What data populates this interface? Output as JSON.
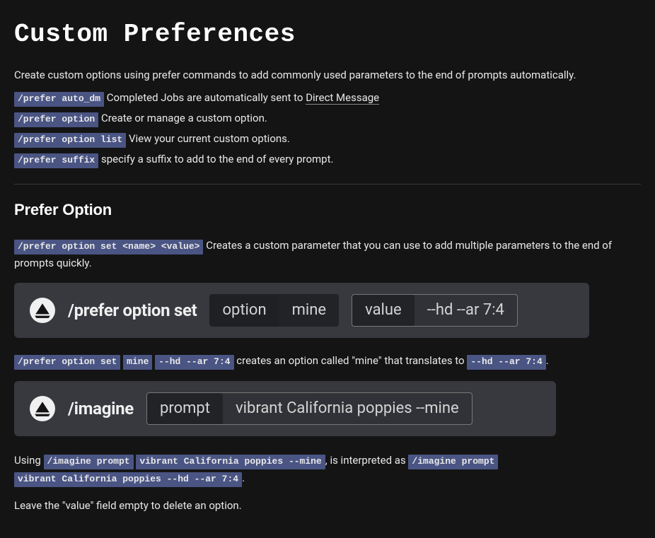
{
  "title": "Custom Preferences",
  "intro": "Create custom options using prefer commands to add commonly used parameters to the end of prompts automatically.",
  "cmds": [
    {
      "chip": "/prefer auto_dm",
      "before": "Completed Jobs are automatically sent to ",
      "link": "Direct Message",
      "after": ""
    },
    {
      "chip": "/prefer option",
      "before": "Create or manage a custom option.",
      "link": "",
      "after": ""
    },
    {
      "chip": "/prefer option list",
      "before": "View your current custom options.",
      "link": "",
      "after": ""
    },
    {
      "chip": "/prefer suffix",
      "before": "specify a suffix to add to the end of every prompt.",
      "link": "",
      "after": ""
    }
  ],
  "section": {
    "heading": "Prefer Option",
    "set_chip": "/prefer option set <name> <value>",
    "set_desc": "Creates a custom parameter that you can use to add multiple parameters to the end of prompts quickly."
  },
  "bar1": {
    "cmd": "/prefer option set",
    "k1": "option",
    "v1": "mine",
    "k2": "value",
    "v2": "--hd --ar 7:4"
  },
  "expl1": {
    "c1": "/prefer option set",
    "c2": "mine",
    "c3": "--hd --ar 7:4",
    "mid": "creates an option called \"mine\" that translates to ",
    "c4": "--hd --ar 7:4",
    "end": "."
  },
  "bar2": {
    "cmd": "/imagine",
    "k1": "prompt",
    "v1": "vibrant California poppies --mine"
  },
  "expl2": {
    "pre": "Using ",
    "c1": "/imagine prompt",
    "c2": "vibrant California poppies --mine",
    "mid": ", is interpreted as ",
    "c3": "/imagine prompt",
    "c4": "vibrant California poppies --hd --ar 7:4",
    "end": "."
  },
  "footer": "Leave the \"value\" field empty to delete an option."
}
